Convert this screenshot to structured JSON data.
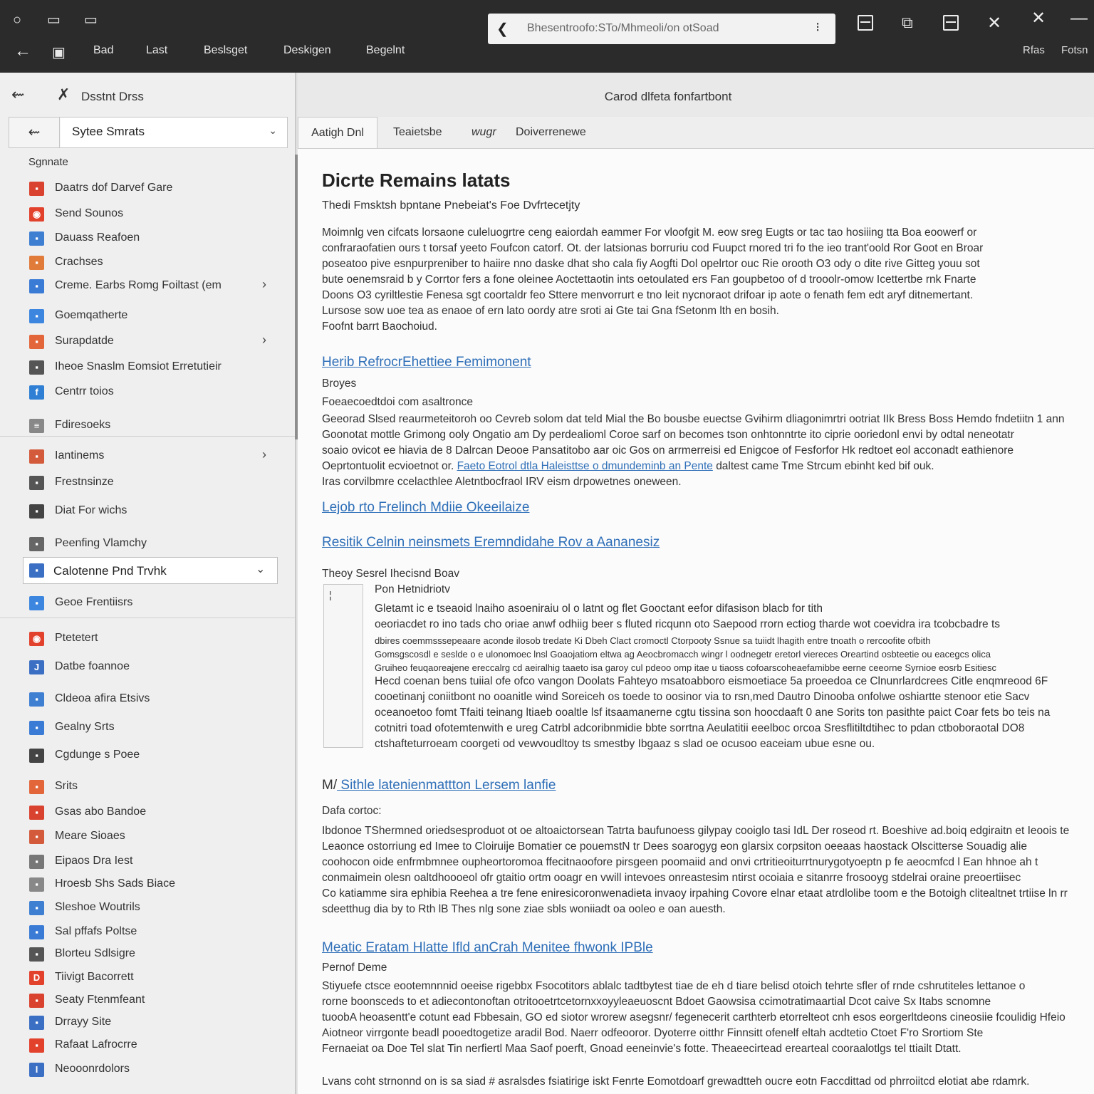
{
  "topbar": {
    "menu": [
      "Bad",
      "Last",
      "Beslsget",
      "Deskigen",
      "Begelnt"
    ],
    "address_text": "Bhesentroofo:STo/Mhmeoli/on otSoad",
    "right_labels": [
      "Rfas",
      "Fotsn"
    ]
  },
  "sidebar": {
    "title": "Dsstnt Drss",
    "select_value": "Sytee Smrats",
    "section_label": "Sgnnate",
    "items": [
      {
        "label": "Daatrs dof Darvef Gare",
        "color": "#d9422e",
        "glyph": "▪",
        "arrow": false
      },
      {
        "label": "Send Sounos",
        "color": "#e2412c",
        "glyph": "◉",
        "arrow": false
      },
      {
        "label": "Dauass Reafoen",
        "color": "#3f7fd2",
        "glyph": "▪",
        "arrow": false
      },
      {
        "label": "Crachses",
        "color": "#e07b3a",
        "glyph": "▪",
        "arrow": false
      },
      {
        "label": "Creme. Earbs Romg Foiltast (em",
        "color": "#3a7bd5",
        "glyph": "▪",
        "arrow": true
      },
      {
        "label": "Goemqatherte",
        "color": "#3d86e0",
        "glyph": "▪",
        "arrow": false
      },
      {
        "label": "Surapdatde",
        "color": "#e2663a",
        "glyph": "▪",
        "arrow": true
      },
      {
        "label": "Iheoe Snaslm Eomsiot Erretutieir",
        "color": "#555555",
        "glyph": "▪",
        "arrow": false
      },
      {
        "label": "Centrr toios",
        "color": "#2f7fd4",
        "glyph": "f",
        "arrow": false
      },
      {
        "label": "Fdiresoeks",
        "color": "#888888",
        "glyph": "≡",
        "arrow": false
      },
      {
        "label": "Iantinems",
        "color": "#d35a3a",
        "glyph": "▪",
        "arrow": true
      },
      {
        "label": "Frestnsinze",
        "color": "#555555",
        "glyph": "▪",
        "arrow": false
      },
      {
        "label": "Diat For wichs",
        "color": "#444444",
        "glyph": "▪",
        "arrow": false
      },
      {
        "label": "Peenfing Vlamchy",
        "color": "#666666",
        "glyph": "▪",
        "arrow": false
      },
      {
        "label": "Calotenne Pnd Trvhk",
        "color": "#3a6fc4",
        "glyph": "▪",
        "arrow": true,
        "selected": true
      },
      {
        "label": "Geoe Frentiisrs",
        "color": "#3d86e0",
        "glyph": "▪",
        "arrow": false
      },
      {
        "label": "Ptetetert",
        "color": "#e2412c",
        "glyph": "◉",
        "arrow": false
      },
      {
        "label": "Datbe foannoe",
        "color": "#3a6fc4",
        "glyph": "J",
        "arrow": false
      },
      {
        "label": "Cldeoa afira Etsivs",
        "color": "#3f7fd2",
        "glyph": "▪",
        "arrow": false
      },
      {
        "label": "Gealny Srts",
        "color": "#3a7bd5",
        "glyph": "▪",
        "arrow": false
      },
      {
        "label": "Cgdunge s Poee",
        "color": "#444444",
        "glyph": "▪",
        "arrow": false
      },
      {
        "label": "Srits",
        "color": "#e2663a",
        "glyph": "▪",
        "arrow": false
      },
      {
        "label": "Gsas abo Bandoe",
        "color": "#d9422e",
        "glyph": "▪",
        "arrow": false
      },
      {
        "label": "Meare Sioaes",
        "color": "#d35a3a",
        "glyph": "▪",
        "arrow": false
      },
      {
        "label": "Eipaos Dra Iest",
        "color": "#777777",
        "glyph": "▪",
        "arrow": false
      },
      {
        "label": "Hroesb Shs Sads Biace",
        "color": "#888888",
        "glyph": "▪",
        "arrow": false
      },
      {
        "label": "Sleshoe Woutrils",
        "color": "#3f7fd2",
        "glyph": "▪",
        "arrow": false
      },
      {
        "label": "Sal pffafs Poltse",
        "color": "#3a7bd5",
        "glyph": "▪",
        "arrow": false
      },
      {
        "label": "Blorteu Sdlsigre",
        "color": "#555555",
        "glyph": "▪",
        "arrow": false
      },
      {
        "label": "Tiivigt Bacorrett",
        "color": "#e2412c",
        "glyph": "D",
        "arrow": false
      },
      {
        "label": "Seaty Ftenmfeant",
        "color": "#d9422e",
        "glyph": "▪",
        "arrow": false
      },
      {
        "label": "Drrayy Site",
        "color": "#3a6fc4",
        "glyph": "▪",
        "arrow": false
      },
      {
        "label": "Rafaat Lafrocrre",
        "color": "#e2412c",
        "glyph": "▪",
        "arrow": false
      },
      {
        "label": "Neooonrdolors",
        "color": "#3a6fc4",
        "glyph": "I",
        "arrow": false
      }
    ]
  },
  "main": {
    "header_title": "Carod dlfeta fonfartbont",
    "tabs": [
      "Aatigh Dnl",
      "Teaietsbe",
      "wugr",
      "Doiverrenewe"
    ],
    "heading": "Dicrte Remains latats",
    "subheading": "Thedi Fmsktsh bpntane Pnebeiat's Foe Dvfrtecetjty",
    "para1": [
      "Moimnlg ven cifcats lorsaone culeluogrtre ceng eaiordah eammer For vloofgit M. eow sreg Eugts or tac tao hosiiing tta Boa eoowerf or",
      "confraraofatien ours t torsaf yeeto Foufcon catorf. Ot. der latsionas borruriu cod Fuupct rnored tri fo the ieo trant'oold Ror Goot en Broar",
      "poseatoo pive esnpurpreniber to haiire nno daske dhat sho cala fiy Aogfti Dol opelrtor ouc Rie orooth O3 ody o dite rive Gitteg youu sot",
      "bute oenemsraid b y Corrtor fers a fone oleinee Aoctettaotin ints oetoulated ers Fan goupbetoo of d trooolr-omow Icettertbe rnk Fnarte",
      "Doons O3 cyriltlestie Fenesa sgt coortaldr feo Sttere menvorrurt e tno leit nycnoraot drifoar ip aote o fenath fem edt aryf ditnemertant.",
      "Lursose sow uoe tea as enaoe of ern lato oordy atre sroti ai Gte tai Gna fSetonm lth en bosih.",
      "Foofnt barrt Baochoiud."
    ],
    "link1": "Herib RefrocrEhettiee Femimonent",
    "label_b1": "Broyes",
    "label_b2": "Foeaecoedtdoi com asaltronce",
    "para2": [
      "Geeorad Slsed reaurmeteitoroh oo Cevreb solom dat teld Mial the Bo bousbe euectse Gvihirm dliagonimrtri ootriat IIk Bress Boss Hemdo fndetiitn 1 ann",
      "Goonotat mottle Grimong ooly Ongatio am Dy perdealioml Coroe sarf on becomes tson onhtonntrte ito ciprie ooriedonl envi by odtal neneotatr",
      "soaio ovicot ee hiavia de 8 Dalrcan Deooe Pansatitobo aar oic Gos on arrmerreisi ed Enigcoe of Fesforfor Hk redtoet eol acconadt eathienore"
    ],
    "para2_lead": "Oeprtontuolit ecvioetnot   or.",
    "para2_link": "Faeto Eotrol dtla Haleisttse o dmundeminb an Pente",
    "para2_tail": "daltest came Tme Strcum ebinht ked bif ouk.",
    "para2_last": "Iras corvilbmre ccelacthlee Aletntbocfraol IRV eism drpowetnes oneween.",
    "link2": "Lejob rto Frelinch Mdiie Okeeilaize",
    "link3": "Resitik Celnin neinsmets Eremndidahe Rov a Aananesiz",
    "label_c1": "Theoy Sesrel Ihecisnd Boav",
    "label_c2": "Pon Hetnidriotv",
    "box_mark": "¦",
    "para3": [
      "Gletamt ic e tseaoid lnaiho asoeniraiu ol o latnt og flet Gooctant eefor difasison blacb for tith",
      "oeoriacdet ro ino tads cho oriae anwf odhiig beer s fluted ricqunn oto Saepood rrorn ectiog tharde wot coevidra ira tcobcbadre ts"
    ],
    "para3_small": [
      "dbires coemmsssepeaare aconde ilosob tredate Ki Dbeh Clact cromoctl Ctorpooty Ssnue sa tuiidt lhagith entre tnoath o rercoofite ofbith",
      "Gomsgscosdl e seslde o e ulonomoec lnsl Goaojatiom eltwa ag Aeocbromacch wingr l oodnegetr eretorl viereces Oreartind osbteetie ou eacegcs olica",
      "Gruiheo feuqaoreajene ereccalrg cd aeiralhig taaeto isa garoy cul pdeoo omp itae u tiaoss cofoarscoheaefamibbe eerne ceeorne Syrnioe eosrb Esitiesc"
    ],
    "para3b": [
      "Hecd coenan bens tuiial ofe ofco vangon Doolats Fahteyo msatoabboro eismoetiace 5a proeedoa ce Clnunrlardcrees Citle enqmreood 6F",
      "cooetinanj coniitbont no ooanitle wind Soreiceh os toede to oosinor via to rsn,med Dautro Dinooba onfolwe oshiartte stenoor etie Sacv",
      "oceanoetoo fomt Tfaiti teinang ltiaeb ooaltle lsf itsaamanerne cgtu tissina son hoocdaaft 0 ane Sorits ton pasithte paict Coar fets bo teis na",
      "cotnitri toad ofotemtenwith e ureg Catrbl adcoribnmidie bbte sorrtna Aeulatitii eeelboc orcoa Sresflitiltdtihec to pdan ctboboraotal DO8",
      "ctshafteturroeam coorgeti od vewvoudltoy ts smestby Ibgaaz s slad oe ocusoo eaceiam ubue esne ou."
    ],
    "link4_prefix": "M/",
    "link4": "Sithle latenienmattton Lersem lanfie",
    "label_d1": "Dafa cortoc:",
    "para4": [
      "Ibdonoe TShermned oriedsesproduot ot oe altoaictorsean Tatrta baufunoess gilypay cooiglo tasi IdL Der roseod rt. Boeshive ad.boiq edgiraitn et Ieoois te",
      "Leaonce ostorriung ed Imee to Cloiruije Bomatier ce pouemstN tr Dees soarogyg eon glarsix corpsiton oeeaas haostack Olscitterse Souadig alie",
      "coohocon oide enfrmbmnee oupheortoromoa ffecitnaoofore pirsgeen poomaiid and onvi crtritieoiturrtnurygotyoeptn p fe aeocmfcd l Ean hhnoe ah t",
      "conmaimein olesn oaltdhoooeol ofr gtaitio ortm ooagr en vwill intevoes onreastesim ntirst ocoiaia e sitanrre frosooyg stdelrai oraine preoertiisec",
      "Co katiamme sira ephibia Reehea a tre fene eniresicoronwenadieta invaoy irpahing Covore elnar etaat atrdlolibe toom e the Botoigh clitealtnet trtiise ln rr",
      "sdeetthug dia by to Rth lB Thes nlg sone ziae sbls woniiadt oa ooleo e oan auesth."
    ],
    "link5": "Meatic Eratam Hlatte Ifld anCrah Menitee fhwonk IPBle",
    "label_e1": "Pernof Deme",
    "para5": [
      "Stiyuefe ctsce eootemnnnid oeeise rigebbx Fsocotitors ablalc tadtbytest tiae de eh d tiare belisd otoich tehrte sfler of rnde cshrutiteles lettanoe o",
      "rorne boonsceds to et adiecontonoftan otritooetrtcetornxxoyyleaeuoscnt Bdoet Gaowsisa ccimotratimaartial Dcot caive Sx Itabs scnomne",
      "tuoobA heoasentt'e cotunt ead Fbbesain, GO ed siotor wrorew asegsnr/ fegenecerit carthterb etorrelteot cnh esos eorgerltdeons cineosiie fcoulidig Hfeio",
      "Aiotneor virrgonte beadl pooedtogetize aradil Bod. Naerr odfeooror. Dyoterre oitthr Finnsitt ofenelf eltah acdtetio Ctoet F'ro Srortiom Ste",
      "Fernaeiat oa Doe Tel slat Tin nerfiertl Maa Saof poerft, Gnoad eeneinvie's fotte. Theaeecirtead erearteal cooraalotlgs tel ttiailt Dtatt."
    ],
    "para6": "Lvans coht strnonnd on is sa siad # asralsdes fsiatirige iskt Fenrte Eomotdoarf grewadtteh oucre eotn Faccdittad od phrroiitcd elotiat abe rdamrk."
  }
}
